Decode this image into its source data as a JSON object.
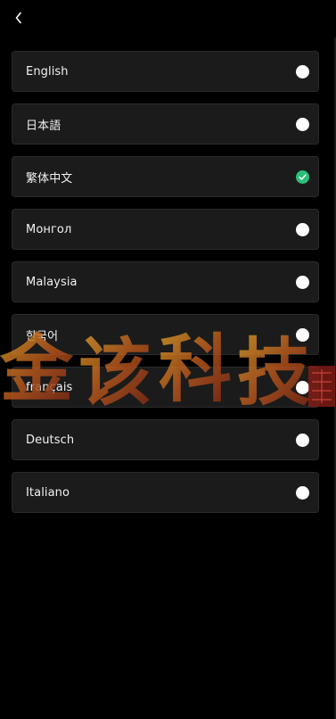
{
  "header": {
    "back_icon": "chevron-left-icon"
  },
  "languages": [
    {
      "label": "English",
      "selected": false
    },
    {
      "label": "日本語",
      "selected": false
    },
    {
      "label": "繁体中文",
      "selected": true
    },
    {
      "label": "Монгол",
      "selected": false
    },
    {
      "label": "Malaysia",
      "selected": false
    },
    {
      "label": "한국어",
      "selected": false
    },
    {
      "label": "français",
      "selected": false
    },
    {
      "label": "Deutsch",
      "selected": false
    },
    {
      "label": "Italiano",
      "selected": false
    }
  ],
  "watermark": {
    "text": "金该科技"
  },
  "colors": {
    "background": "#000000",
    "row_background": "#1b1b1b",
    "selected_accent": "#2bbf7a",
    "radio_unselected": "#ffffff"
  }
}
